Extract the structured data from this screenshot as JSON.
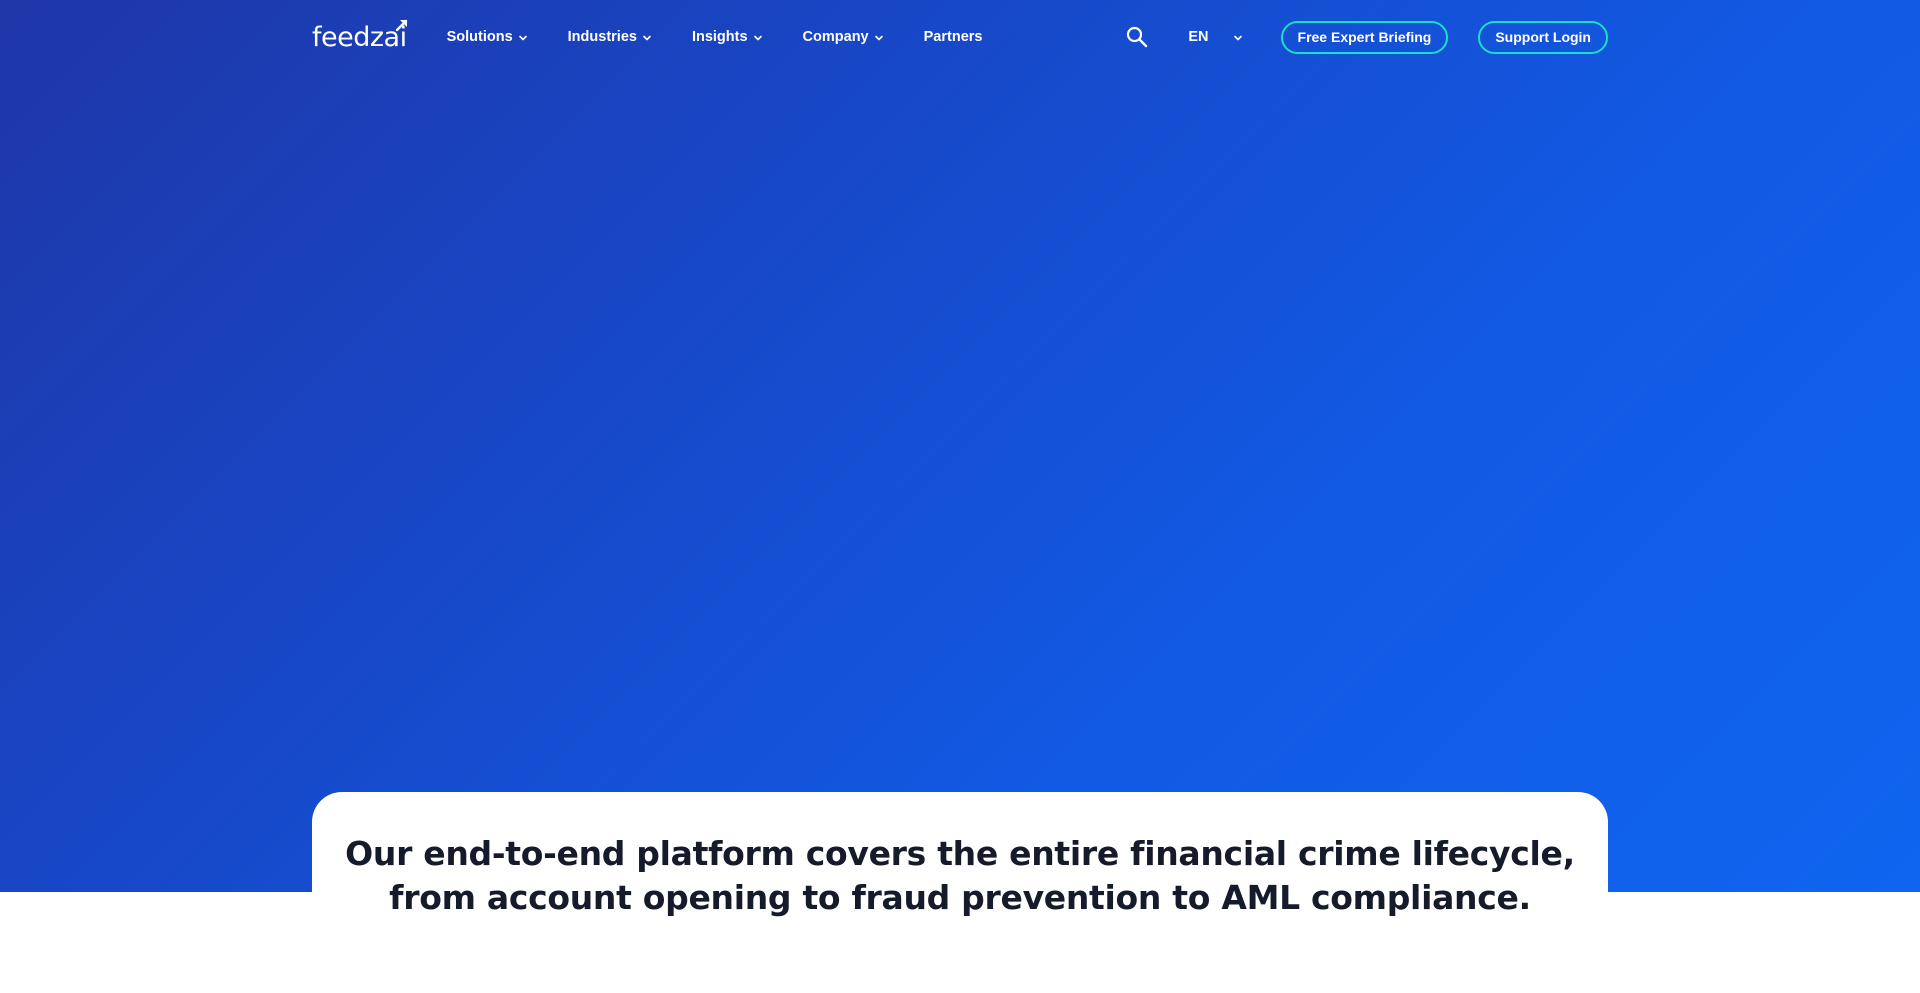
{
  "brand": {
    "logo_text": "feedzai",
    "logo_icon": "arrow-up-right-icon"
  },
  "nav": {
    "items": [
      {
        "label": "Solutions",
        "has_dropdown": true
      },
      {
        "label": "Industries",
        "has_dropdown": true
      },
      {
        "label": "Insights",
        "has_dropdown": true
      },
      {
        "label": "Company",
        "has_dropdown": true
      },
      {
        "label": "Partners",
        "has_dropdown": false
      }
    ],
    "search_icon": "search-icon",
    "language": "EN",
    "cta_briefing": "Free Expert Briefing",
    "cta_login": "Support Login"
  },
  "intro": {
    "line1": "Our end-to-end platform covers the entire financial crime lifecycle,",
    "line2": "from account opening to fraud prevention to AML compliance."
  },
  "colors": {
    "hero_gradient_start": "#1f36a8",
    "hero_gradient_end": "#0f65f0",
    "accent_outline": "#19e0c4",
    "text_dark": "#151b2b"
  }
}
